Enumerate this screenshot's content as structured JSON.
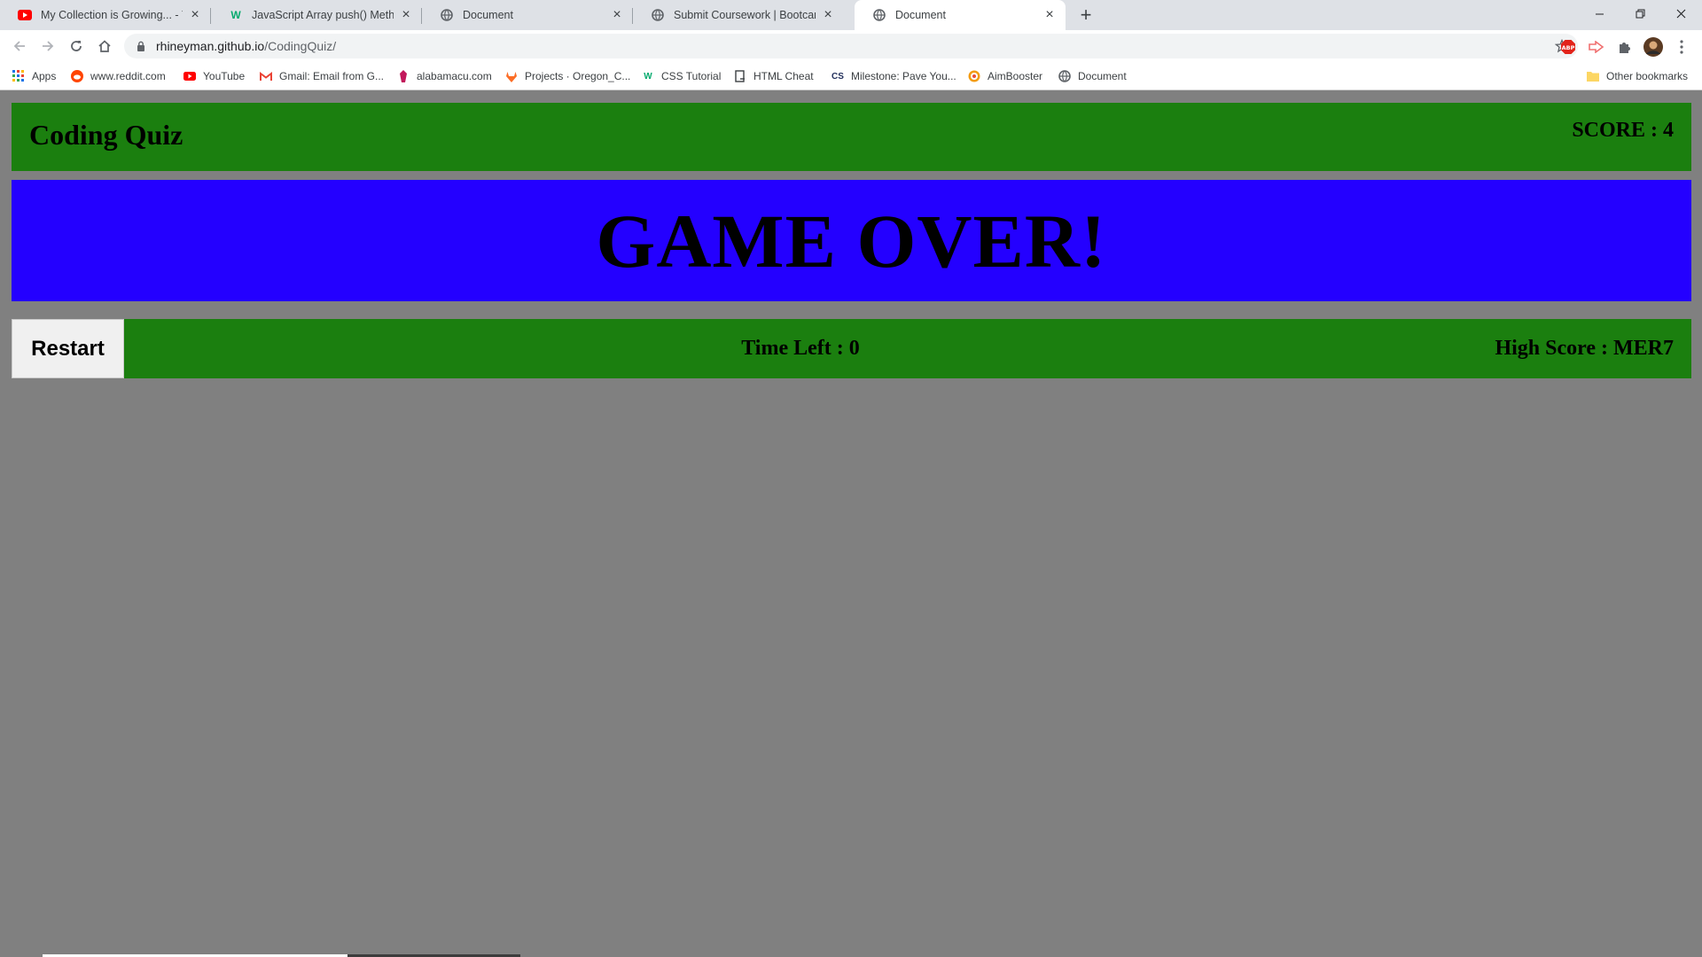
{
  "browser": {
    "tabs": [
      {
        "title": "My Collection is Growing... - You",
        "icon": "youtube-icon"
      },
      {
        "title": "JavaScript Array push() Method",
        "icon": "w3schools-icon"
      },
      {
        "title": "Document",
        "icon": "globe-icon"
      },
      {
        "title": "Submit Coursework | Bootcamp S",
        "icon": "globe-icon"
      },
      {
        "title": "Document",
        "icon": "globe-icon",
        "active": true
      }
    ],
    "url_host": "rhineyman.github.io",
    "url_path": "/CodingQuiz/",
    "bookmarks": [
      {
        "label": "Apps",
        "icon": "apps-grid-icon"
      },
      {
        "label": "www.reddit.com",
        "icon": "reddit-icon"
      },
      {
        "label": "YouTube",
        "icon": "youtube-icon"
      },
      {
        "label": "Gmail: Email from G...",
        "icon": "gmail-icon"
      },
      {
        "label": "alabamacu.com",
        "icon": "alabamacu-icon"
      },
      {
        "label": "Projects · Oregon_C...",
        "icon": "gitlab-icon"
      },
      {
        "label": "CSS Tutorial",
        "icon": "w3schools-icon"
      },
      {
        "label": "HTML Cheat",
        "icon": "document-icon"
      },
      {
        "label": "Milestone: Pave You...",
        "icon": "cs-icon"
      },
      {
        "label": "AimBooster",
        "icon": "aimbooster-icon"
      },
      {
        "label": "Document",
        "icon": "globe-icon"
      }
    ],
    "other_bookmarks": "Other bookmarks"
  },
  "quiz": {
    "title": "Coding Quiz",
    "score_text": "SCORE : 4",
    "banner_text": "GAME OVER!",
    "restart_label": "Restart",
    "time_left_text": "Time Left : 0",
    "high_score_text": "High Score : MER7"
  },
  "colors": {
    "bar_green": "#1b7f0f",
    "banner_blue": "#2400ff",
    "page_gray": "#808080"
  }
}
